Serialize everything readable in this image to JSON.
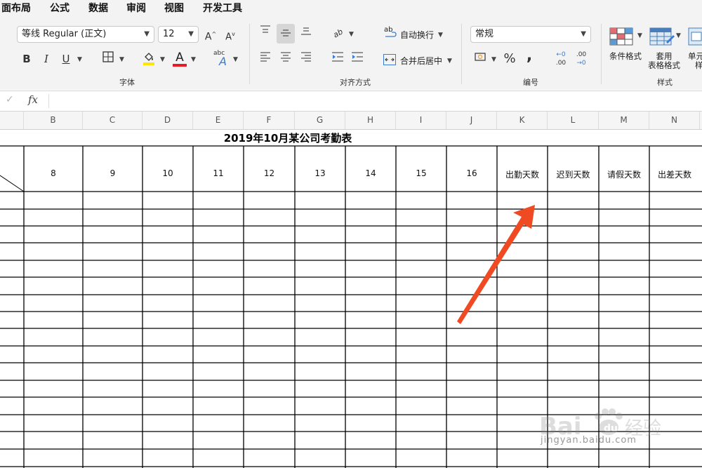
{
  "menu": {
    "items": [
      "面布局",
      "公式",
      "数据",
      "审阅",
      "视图",
      "开发工具"
    ]
  },
  "ribbon": {
    "font_name": "等线 Regular (正文)",
    "font_size": "12",
    "groups": {
      "font": "字体",
      "alignment": "对齐方式",
      "number": "编号",
      "styles": "样式"
    },
    "wrap_text": "自动换行",
    "merge_center": "合并后居中",
    "number_format": "常规",
    "conditional_format": "条件格式",
    "table_format_line1": "套用",
    "table_format_line2": "表格格式",
    "cell_styles_line1": "单元",
    "cell_styles_line2": "样",
    "bold": "B",
    "italic": "I",
    "underline": "U",
    "percent": "%",
    "comma": ",",
    "increase_font": "A",
    "decrease_font": "A",
    "dec_left": ".00",
    "dec_right": ".00",
    "font_color_letter": "A",
    "abc": "abc",
    "ab": "ab"
  },
  "formula_bar": {
    "fx": "fx",
    "value": ""
  },
  "columns": [
    "B",
    "C",
    "D",
    "E",
    "F",
    "G",
    "H",
    "I",
    "J",
    "K",
    "L",
    "M",
    "N"
  ],
  "sheet": {
    "title": "2019年10月某公司考勤表",
    "headers": [
      "8",
      "9",
      "10",
      "11",
      "12",
      "13",
      "14",
      "15",
      "16",
      "出勤天数",
      "迟到天数",
      "请假天数",
      "出差天数"
    ]
  },
  "colors": {
    "ribbon_bg": "#f3f3f3",
    "arrow": "#f04a23",
    "font_color_bar": "#e51c23",
    "highlight_bar": "#ffe600"
  },
  "watermark": {
    "brand": "Baidu 经验",
    "url": "jingyan.baidu.com"
  }
}
